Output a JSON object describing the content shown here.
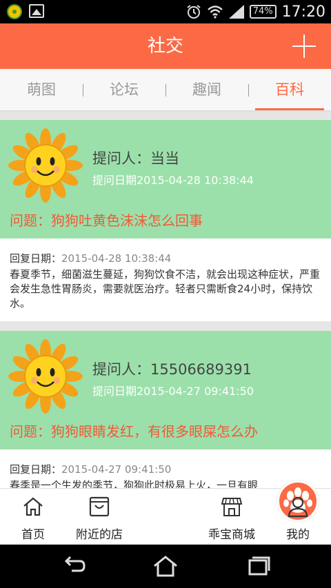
{
  "status_bar": {
    "battery": "74%",
    "time": "17:20"
  },
  "header": {
    "title": "社交"
  },
  "tabs": [
    {
      "label": "萌图",
      "active": false
    },
    {
      "label": "论坛",
      "active": false
    },
    {
      "label": "趣闻",
      "active": false
    },
    {
      "label": "百科",
      "active": true
    }
  ],
  "posts": [
    {
      "asker": "提问人：当当",
      "ask_date": "提问日期2015-04-28 10:38:44",
      "question": "问题：狗狗吐黄色沫沫怎么回事",
      "reply_label": "回复日期：",
      "reply_date": "2015-04-28 10:38:44",
      "reply_text": "春夏季节，细菌滋生蔓延，狗狗饮食不洁，就会出现这种症状，严重会发生急性胃肠炎，需要就医治疗。轻者只需断食24小时，保持饮水。"
    },
    {
      "asker": "提问人：15506689391",
      "ask_date": "提问日期2015-04-27 09:41:50",
      "question": "问题：狗狗眼睛发红，有很多眼屎怎么办",
      "reply_label": "回复日期：",
      "reply_date": "2015-04-27 09:41:50",
      "reply_text": "春季是一个生发的季节，狗狗此时极易上火，一旦有眼"
    }
  ],
  "bottom_nav": [
    {
      "label": "首页",
      "icon": "home-icon"
    },
    {
      "label": "附近的店",
      "icon": "shop-bag-icon"
    },
    {
      "label": "",
      "icon": "paw-icon"
    },
    {
      "label": "乖宝商城",
      "icon": "store-icon"
    },
    {
      "label": "我的",
      "icon": "user-icon"
    }
  ],
  "colors": {
    "accent": "#fc6a45",
    "card_green": "#9be0aa",
    "question_red": "#ef5a3a"
  }
}
